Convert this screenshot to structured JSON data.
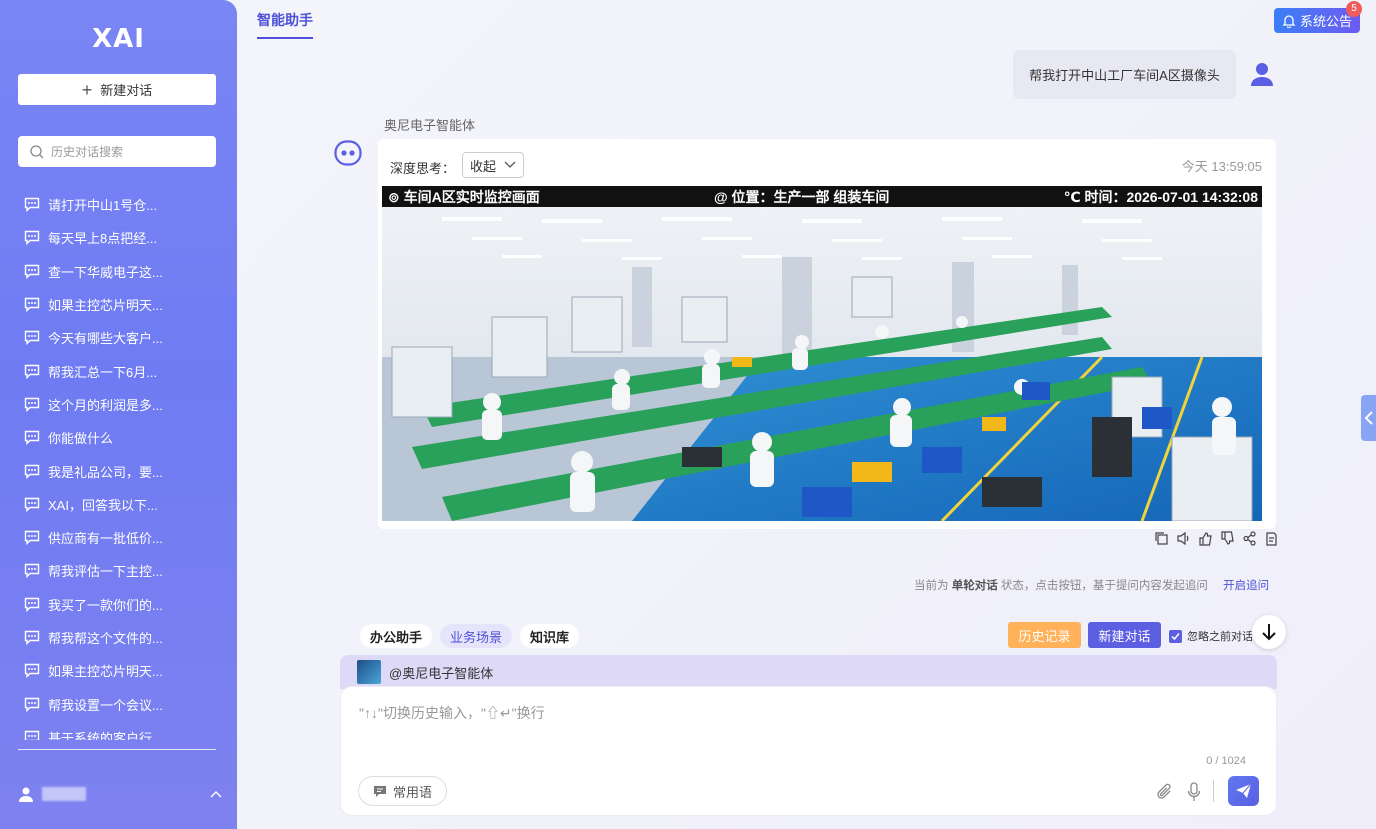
{
  "sidebar": {
    "logo": "XAI",
    "new_chat_label": "新建对话",
    "search_placeholder": "历史对话搜索",
    "history": [
      "请打开中山1号仓...",
      "每天早上8点把经...",
      "查一下华威电子这...",
      "如果主控芯片明天...",
      "今天有哪些大客户...",
      "帮我汇总一下6月...",
      "这个月的利润是多...",
      "你能做什么",
      "我是礼品公司，要...",
      "XAI，回答我以下...",
      "供应商有一批低价...",
      "帮我评估一下主控...",
      "我买了一款你们的...",
      "帮我帮这个文件的...",
      "如果主控芯片明天...",
      "帮我设置一个会议...",
      "基于系统的客户行"
    ]
  },
  "header": {
    "tab_label": "智能助手",
    "notice_label": "系统公告",
    "notice_count": "5"
  },
  "conversation": {
    "user_message": "帮我打开中山工厂车间A区摄像头",
    "agent_name": "奥尼电子智能体",
    "think_label": "深度思考：",
    "think_toggle": "收起",
    "timestamp": "今天 13:59:05",
    "camera": {
      "title": "⊚ 车间A区实时监控画面",
      "location": "@ 位置：生产一部  组装车间",
      "time": "℃ 时间：2026-07-01 14:32:08"
    }
  },
  "status": {
    "prefix": "当前为",
    "mode": "单轮对话",
    "suffix": "状态，点击按钮，基于提问内容发起追问",
    "link": "开启追问"
  },
  "composer": {
    "tools": [
      "办公助手",
      "业务场景",
      "知识库"
    ],
    "history_btn": "历史记录",
    "new_chat_btn": "新建对话",
    "ignore_label": "忽略之前对话",
    "agent_tag": "@奥尼电子智能体",
    "placeholder": "\"↑↓\"切换历史输入，\"⇧↵\"换行",
    "counter": "0 / 1024",
    "phrases_label": "常用语"
  },
  "colors": {
    "sidebar": "#7480f3",
    "accent": "#4e51d8",
    "history_button": "#ffb25a",
    "new_chat_button": "#5d5fe2"
  }
}
